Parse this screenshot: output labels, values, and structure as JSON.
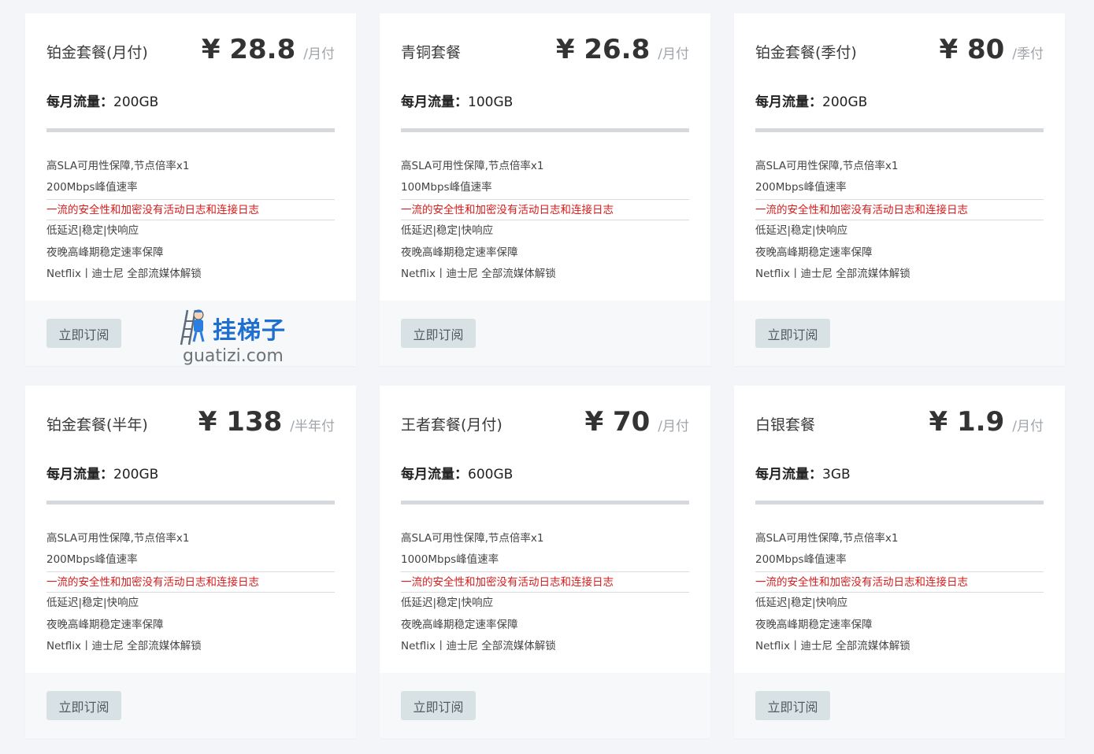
{
  "cards": [
    {
      "name": "铂金套餐(月付)",
      "price": "¥ 28.8",
      "period": "/月付",
      "traffic_label": "每月流量：",
      "traffic_value": "200GB",
      "features": [
        "高SLA可用性保障,节点倍率x1",
        "200Mbps峰值速率",
        "一流的安全性和加密没有活动日志和连接日志",
        "低延迟|稳定|快响应",
        "夜晚高峰期稳定速率保障",
        "Netflix丨迪士尼 全部流媒体解锁"
      ],
      "button": "立即订阅"
    },
    {
      "name": "青铜套餐",
      "price": "¥ 26.8",
      "period": "/月付",
      "traffic_label": "每月流量：",
      "traffic_value": "100GB",
      "features": [
        "高SLA可用性保障,节点倍率x1",
        "100Mbps峰值速率",
        "一流的安全性和加密没有活动日志和连接日志",
        "低延迟|稳定|快响应",
        "夜晚高峰期稳定速率保障",
        "Netflix丨迪士尼 全部流媒体解锁"
      ],
      "button": "立即订阅"
    },
    {
      "name": "铂金套餐(季付)",
      "price": "¥ 80",
      "period": "/季付",
      "traffic_label": "每月流量：",
      "traffic_value": "200GB",
      "features": [
        "高SLA可用性保障,节点倍率x1",
        "200Mbps峰值速率",
        "一流的安全性和加密没有活动日志和连接日志",
        "低延迟|稳定|快响应",
        "夜晚高峰期稳定速率保障",
        "Netflix丨迪士尼 全部流媒体解锁"
      ],
      "button": "立即订阅"
    },
    {
      "name": "铂金套餐(半年)",
      "price": "¥ 138",
      "period": "/半年付",
      "traffic_label": "每月流量：",
      "traffic_value": "200GB",
      "features": [
        "高SLA可用性保障,节点倍率x1",
        "200Mbps峰值速率",
        "一流的安全性和加密没有活动日志和连接日志",
        "低延迟|稳定|快响应",
        "夜晚高峰期稳定速率保障",
        "Netflix丨迪士尼 全部流媒体解锁"
      ],
      "button": "立即订阅"
    },
    {
      "name": "王者套餐(月付)",
      "price": "¥ 70",
      "period": "/月付",
      "traffic_label": "每月流量：",
      "traffic_value": "600GB",
      "features": [
        "高SLA可用性保障,节点倍率x1",
        "1000Mbps峰值速率",
        "一流的安全性和加密没有活动日志和连接日志",
        "低延迟|稳定|快响应",
        "夜晚高峰期稳定速率保障",
        "Netflix丨迪士尼 全部流媒体解锁"
      ],
      "button": "立即订阅"
    },
    {
      "name": "白银套餐",
      "price": "¥ 1.9",
      "period": "/月付",
      "traffic_label": "每月流量：",
      "traffic_value": "3GB",
      "features": [
        "高SLA可用性保障,节点倍率x1",
        "200Mbps峰值速率",
        "一流的安全性和加密没有活动日志和连接日志",
        "低延迟|稳定|快响应",
        "夜晚高峰期稳定速率保障",
        "Netflix丨迪士尼 全部流媒体解锁"
      ],
      "button": "立即订阅"
    }
  ],
  "watermark": {
    "title": "挂梯子",
    "domain": "guatizi.com",
    "icon": "ladder-mascot-icon"
  },
  "colors": {
    "highlight": "#d61a1a",
    "button_bg": "#d8e1e4",
    "page_bg": "#f3f5f8"
  }
}
